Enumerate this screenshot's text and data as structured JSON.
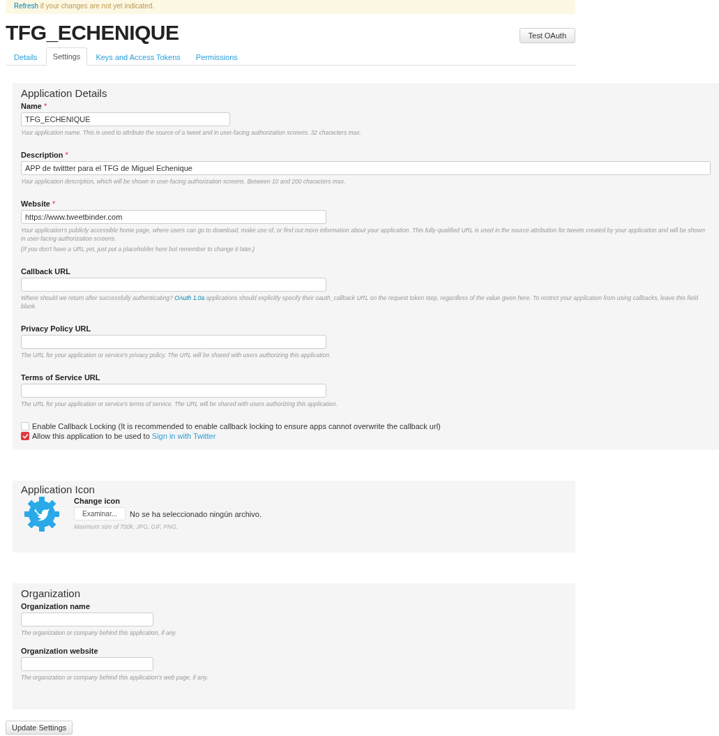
{
  "notice": {
    "link": "Refresh",
    "text": " if your changes are not yet indicated."
  },
  "title": "TFG_ECHENIQUE",
  "test_button": "Test OAuth",
  "tabs": [
    {
      "label": "Details",
      "selected": false
    },
    {
      "label": "Settings",
      "selected": true
    },
    {
      "label": "Keys and Access Tokens",
      "selected": false
    },
    {
      "label": "Permissions",
      "selected": false
    }
  ],
  "details": {
    "heading": "Application Details",
    "fields": [
      {
        "label": "Name",
        "required_mark": "*",
        "value": "TFG_ECHENIQUE",
        "help": [
          {
            "text": "Your application name. This is used to attribute the source of a tweet and in user-facing authorization screens. 32 characters max."
          }
        ]
      },
      {
        "label": "Description",
        "required_mark": "*",
        "value": "APP de twittter para el TFG de Miguel Echenique",
        "help": [
          {
            "text": "Your application description, which will be shown in user-facing authorization screens. Between 10 and 200 characters max."
          }
        ]
      },
      {
        "label": "Website",
        "required_mark": "*",
        "value": "https://www.tweetbinder.com",
        "help": [
          {
            "text": "Your application's publicly accessible home page, where users can go to download, make use of, or find out more information about your application. This fully-qualified URL is used in the source attribution for tweets created by your application and will be shown in user-facing authorization screens."
          },
          {
            "text": "(If you don't have a URL yet, just put a placeholder here but remember to change it later.)"
          }
        ]
      },
      {
        "label": "Callback URL",
        "help": [
          {
            "text": "Where should we return after successfully authenticating? ",
            "link": "OAuth 1.0a",
            "after": " applications should explicitly specify their oauth_callback URL on the request token step, regardless of the value given here. To restrict your application from using callbacks, leave this field blank."
          }
        ]
      },
      {
        "label": "Privacy Policy URL",
        "help": [
          {
            "text": "The URL for your application or service's privacy policy. The URL will be shared with users authorizing this application."
          }
        ]
      },
      {
        "label": "Terms of Service URL",
        "help": [
          {
            "text": "The URL for your application or service's terms of service. The URL will be shared with users authorizing this application."
          }
        ]
      }
    ],
    "checkboxes": [
      {
        "text": "Enable Callback Locking (It is recommended to enable callback locking to ensure apps cannot overwrite the callback url)",
        "checked": false
      },
      {
        "text": "Allow this application to be used to ",
        "link": "Sign in with Twitter",
        "checked": true
      }
    ]
  },
  "icon_section": {
    "heading": "Application Icon",
    "label": "Change icon",
    "file_button": "Examinar...",
    "file_status": "No se ha seleccionado ningún archivo.",
    "help": "Maximum size of 700k. JPG, GIF, PNG."
  },
  "organization": {
    "heading": "Organization",
    "fields": [
      {
        "label": "Organization name",
        "help": [
          {
            "text": "The organization or company behind this application, if any."
          }
        ]
      },
      {
        "label": "Organization website",
        "help": [
          {
            "text": "The organization or company behind this application's web page, if any."
          }
        ]
      }
    ]
  },
  "submit": "Update Settings"
}
